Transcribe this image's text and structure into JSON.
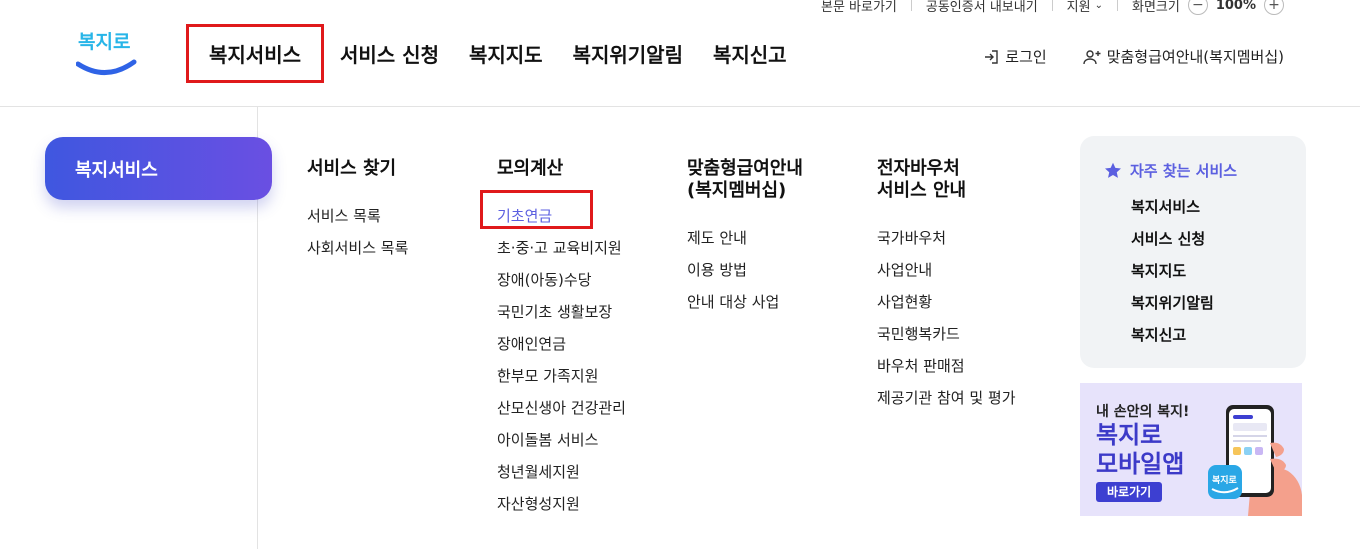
{
  "utility": {
    "skip": "본문 바로가기",
    "cert": "공동인증서 내보내기",
    "support": "지원",
    "zoom_label": "화면크기",
    "zoom_value": "100%"
  },
  "logo": {
    "text": "복지로"
  },
  "gnb": [
    "복지서비스",
    "서비스 신청",
    "복지지도",
    "복지위기알림",
    "복지신고"
  ],
  "header_right": {
    "login": "로그인",
    "member": "맞춤형급여안내(복지멤버십)"
  },
  "side": {
    "title": "복지서비스"
  },
  "columns": [
    {
      "title": "서비스 찾기",
      "items": [
        "서비스 목록",
        "사회서비스 목록"
      ]
    },
    {
      "title": "모의계산",
      "items": [
        "기초연금",
        "초·중·고 교육비지원",
        "장애(아동)수당",
        "국민기초 생활보장",
        "장애인연금",
        "한부모 가족지원",
        "산모신생아 건강관리",
        "아이돌봄 서비스",
        "청년월세지원",
        "자산형성지원"
      ]
    },
    {
      "title_l1": "맞춤형급여안내",
      "title_l2": "(복지멤버십)",
      "items": [
        "제도 안내",
        "이용 방법",
        "안내 대상 사업"
      ]
    },
    {
      "title_l1": "전자바우처",
      "title_l2": "서비스 안내",
      "items": [
        "국가바우처",
        "사업안내",
        "사업현황",
        "국민행복카드",
        "바우처 판매점",
        "제공기관 참여 및 평가"
      ]
    }
  ],
  "favorites": {
    "title": "자주 찾는 서비스",
    "items": [
      "복지서비스",
      "서비스 신청",
      "복지지도",
      "복지위기알림",
      "복지신고"
    ]
  },
  "banner": {
    "line1": "내 손안의 복지!",
    "line2": "복지로",
    "line3": "모바일앱",
    "button": "바로가기",
    "app_icon": "복지로"
  },
  "colors": {
    "accent": "#5b5fe0",
    "highlight_box": "#e0191b",
    "pill_start": "#3f57e0",
    "pill_end": "#6a4fe2"
  }
}
